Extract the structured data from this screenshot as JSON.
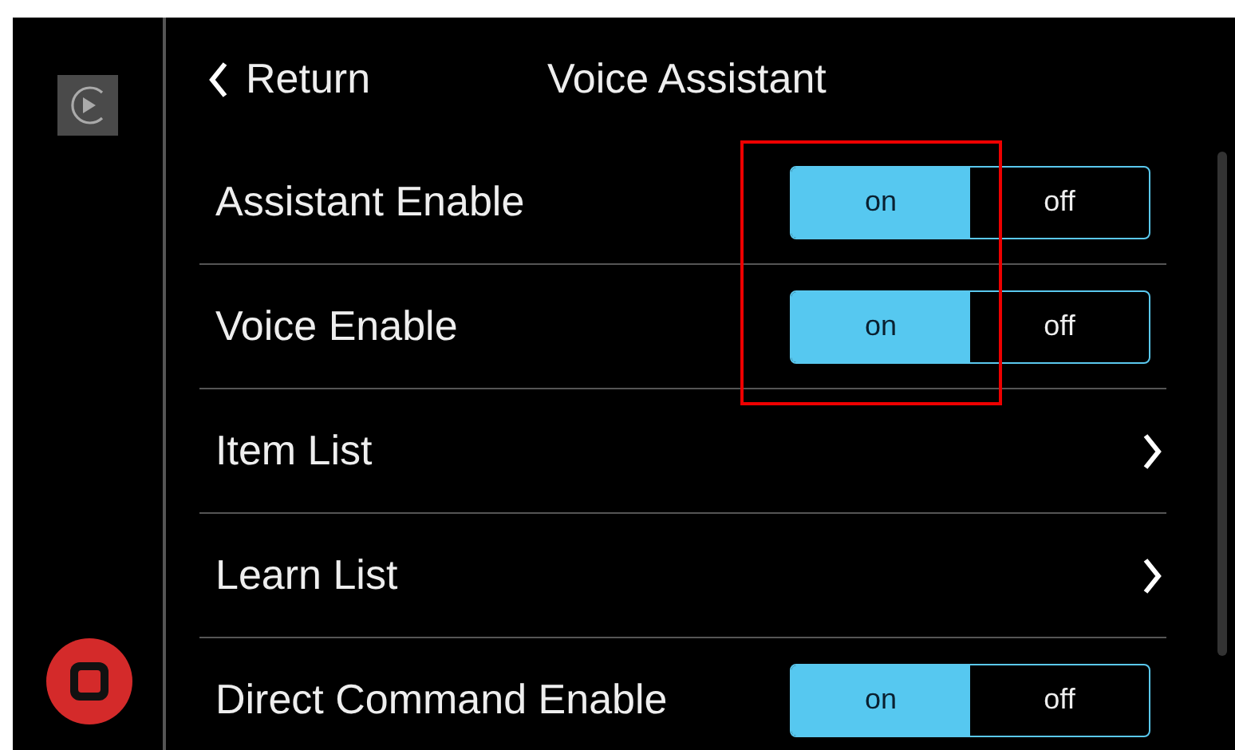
{
  "header": {
    "back_label": "Return",
    "title": "Voice Assistant"
  },
  "rows": [
    {
      "kind": "toggle",
      "label": "Assistant Enable",
      "options": [
        {
          "label": "on",
          "selected": true
        },
        {
          "label": "off",
          "selected": false
        }
      ]
    },
    {
      "kind": "toggle",
      "label": "Voice Enable",
      "options": [
        {
          "label": "on",
          "selected": true
        },
        {
          "label": "off",
          "selected": false
        }
      ]
    },
    {
      "kind": "link",
      "label": "Item List"
    },
    {
      "kind": "link",
      "label": "Learn List"
    },
    {
      "kind": "toggle",
      "label": "Direct Command Enable",
      "options": [
        {
          "label": "on",
          "selected": true
        },
        {
          "label": "off",
          "selected": false
        }
      ]
    }
  ]
}
